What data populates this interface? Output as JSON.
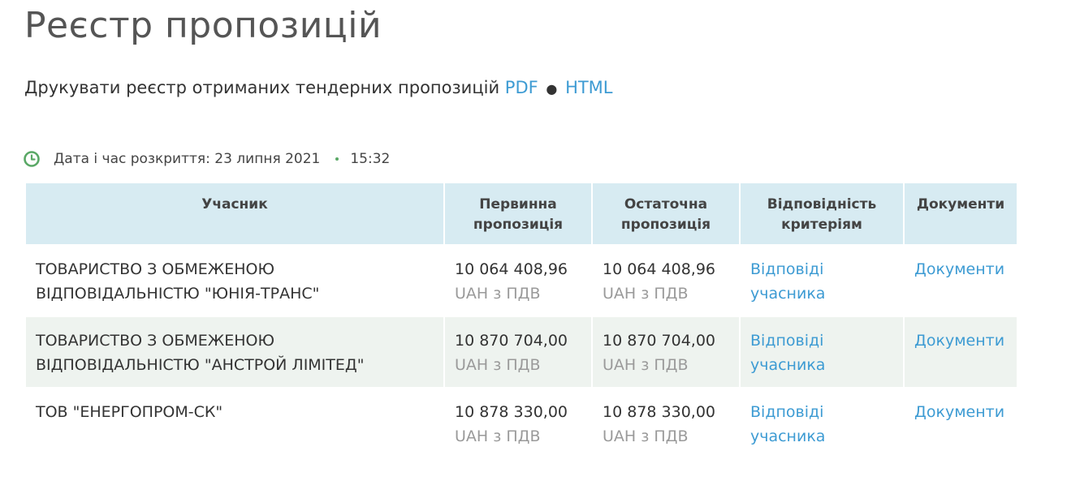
{
  "page": {
    "title": "Реєстр пропозицій"
  },
  "print": {
    "label": "Друкувати реєстр отриманих тендерних пропозицій",
    "pdf_link": "PDF",
    "separator": "●",
    "html_link": "HTML"
  },
  "opening": {
    "label": "Дата і час розкриття: 23 липня 2021",
    "time": "15:32",
    "icon": "clock-icon"
  },
  "table": {
    "headers": {
      "participant": "Учасник",
      "initial": "Первинна пропозиція",
      "final": "Остаточна пропозиція",
      "criteria": "Відповідність критеріям",
      "documents": "Документи"
    },
    "rows": [
      {
        "participant": "ТОВАРИСТВО З ОБМЕЖЕНОЮ ВІДПОВІДАЛЬНІСТЮ \"ЮНІЯ-ТРАНС\"",
        "initial_amount": "10 064 408,96",
        "initial_currency": "UAH з ПДВ",
        "final_amount": "10 064 408,96",
        "final_currency": "UAH з ПДВ",
        "criteria_link": "Відповіді учасника",
        "documents_link": "Документи"
      },
      {
        "participant": "ТОВАРИСТВО З ОБМЕЖЕНОЮ ВІДПОВІДАЛЬНІСТЮ \"АНСТРОЙ ЛІМІТЕД\"",
        "initial_amount": "10 870 704,00",
        "initial_currency": "UAH з ПДВ",
        "final_amount": "10 870 704,00",
        "final_currency": "UAH з ПДВ",
        "criteria_link": "Відповіді учасника",
        "documents_link": "Документи"
      },
      {
        "participant": "ТОВ \"ЕНЕРГОПРОМ-СК\"",
        "initial_amount": "10 878 330,00",
        "initial_currency": "UAH з ПДВ",
        "final_amount": "10 878 330,00",
        "final_currency": "UAH з ПДВ",
        "criteria_link": "Відповіді учасника",
        "documents_link": "Документи"
      }
    ]
  },
  "colors": {
    "link": "#3d9bd3",
    "header_bg": "#d7ebf2",
    "alt_row_bg": "#eef3ef",
    "clock_green": "#5aa866",
    "muted_text": "#9a9a9a"
  }
}
